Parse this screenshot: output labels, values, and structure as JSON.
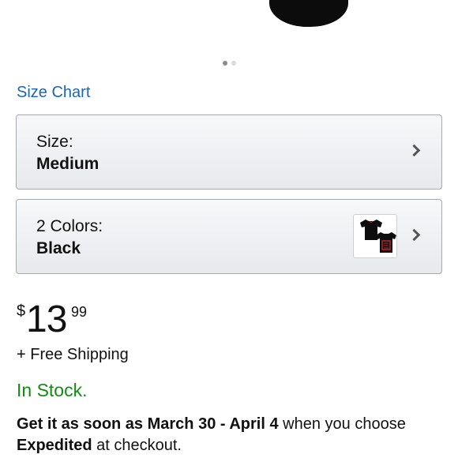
{
  "image_carousel": {
    "total_images": 2,
    "active_index": 0
  },
  "size_chart_link": "Size Chart",
  "size_selector": {
    "label": "Size:",
    "value": "Medium"
  },
  "color_selector": {
    "label": "2 Colors:",
    "value": "Black"
  },
  "price": {
    "currency": "$",
    "whole": "13",
    "fraction": "99"
  },
  "shipping": "+ Free Shipping",
  "stock_status": "In Stock.",
  "delivery": {
    "prefix": "Get it as soon as March 30 - April 4",
    "middle": " when you choose ",
    "method": "Expedited",
    "suffix": " at checkout."
  },
  "colors": {
    "link": "#1a66b3",
    "in_stock": "#138b13",
    "thumb_accent": "#c0262d"
  }
}
